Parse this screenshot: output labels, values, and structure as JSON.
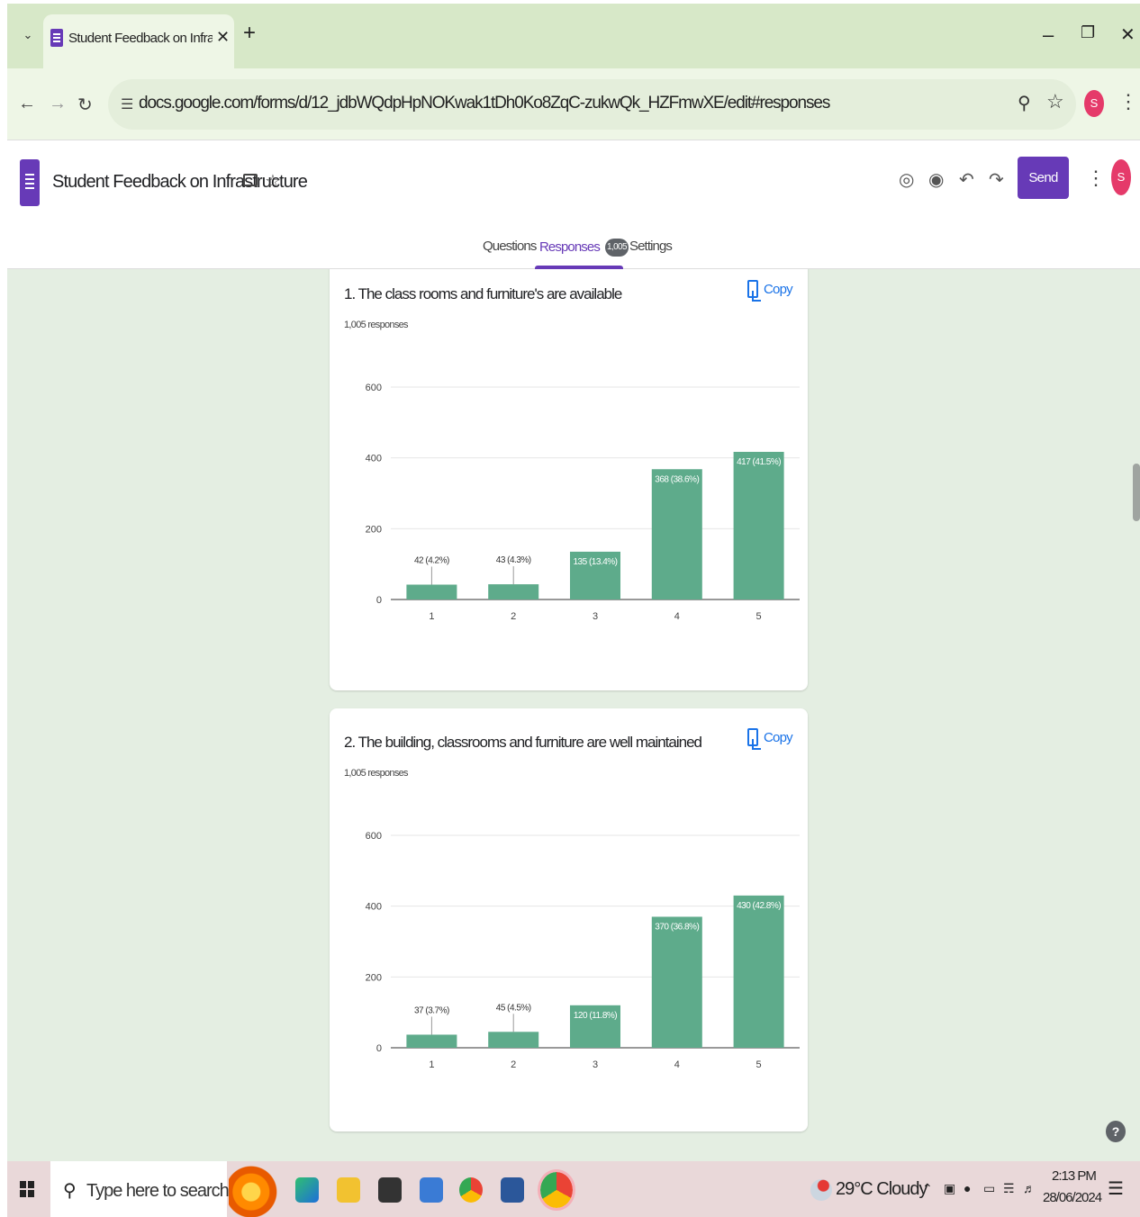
{
  "browser": {
    "tab_title": "Student Feedback on Infrastruc",
    "new_tab": "+",
    "url": "docs.google.com/forms/d/12_jdbWQdpHpNOKwak1tDh0Ko8ZqC-zukwQk_HZFmwXE/edit#responses",
    "profile_initial": "S"
  },
  "forms": {
    "title": "Student Feedback on Infrastructure",
    "send_label": "Send",
    "avatar_initial": "S",
    "tabs": {
      "questions": "Questions",
      "responses": "Responses",
      "responses_count": "1,005",
      "settings": "Settings"
    }
  },
  "colors": {
    "bar": "#5eab8b",
    "accent": "#673ab7",
    "link": "#1a73e8"
  },
  "questions": [
    {
      "title": "1. The class rooms and furniture's are available",
      "count_label": "1,005 responses",
      "copy_label": "Copy",
      "chart_data": {
        "type": "bar",
        "categories": [
          "1",
          "2",
          "3",
          "4",
          "5"
        ],
        "values": [
          42,
          43,
          135,
          368,
          417
        ],
        "data_labels": [
          "42 (4.2%)",
          "43 (4.3%)",
          "135 (13.4%)",
          "368 (38.6%)",
          "417 (41.5%)"
        ],
        "y_ticks": [
          "0",
          "200",
          "400",
          "600"
        ],
        "ylim": [
          0,
          600
        ],
        "grid": true,
        "title": "",
        "xlabel": "",
        "ylabel": ""
      }
    },
    {
      "title": "2. The building, classrooms and furniture are well maintained",
      "count_label": "1,005 responses",
      "copy_label": "Copy",
      "chart_data": {
        "type": "bar",
        "categories": [
          "1",
          "2",
          "3",
          "4",
          "5"
        ],
        "values": [
          37,
          45,
          120,
          370,
          430
        ],
        "data_labels": [
          "37 (3.7%)",
          "45 (4.5%)",
          "120 (11.8%)",
          "370 (36.8%)",
          "430 (42.8%)"
        ],
        "y_ticks": [
          "0",
          "200",
          "400",
          "600"
        ],
        "ylim": [
          0,
          600
        ],
        "grid": true,
        "title": "",
        "xlabel": "",
        "ylabel": ""
      }
    }
  ],
  "taskbar": {
    "search_placeholder": "Type here to search",
    "weather": "29°C  Cloudy",
    "time": "2:13 PM",
    "date": "28/06/2024"
  }
}
